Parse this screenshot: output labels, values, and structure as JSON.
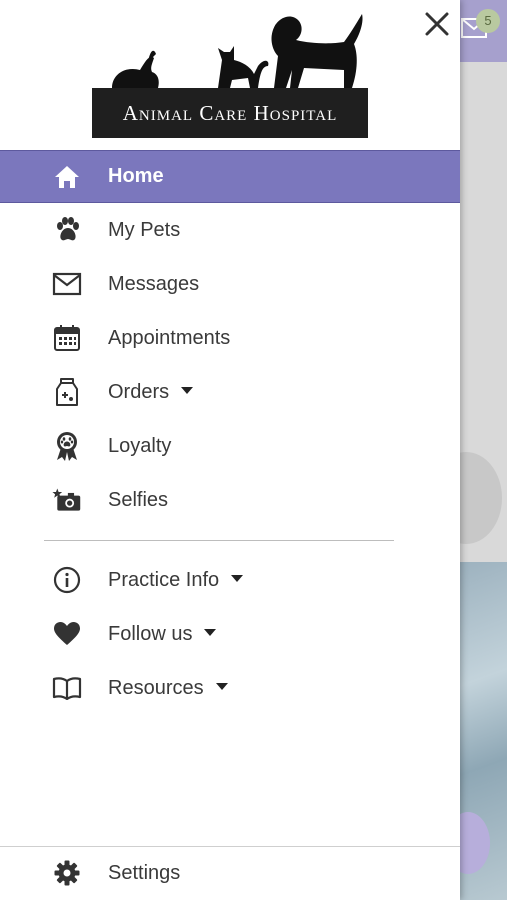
{
  "background": {
    "badge_count": "5"
  },
  "drawer": {
    "close_icon": "close-icon",
    "logo_text": "Animal Care Hospital",
    "menu": [
      {
        "label": "Home",
        "icon": "home-icon",
        "active": true
      },
      {
        "label": "My Pets",
        "icon": "paw-icon"
      },
      {
        "label": "Messages",
        "icon": "envelope-icon"
      },
      {
        "label": "Appointments",
        "icon": "calendar-icon"
      },
      {
        "label": "Orders",
        "icon": "food-bag-icon",
        "expandable": true
      },
      {
        "label": "Loyalty",
        "icon": "ribbon-icon"
      },
      {
        "label": "Selfies",
        "icon": "camera-icon"
      }
    ],
    "secondary_menu": [
      {
        "label": "Practice Info",
        "icon": "info-icon",
        "expandable": true
      },
      {
        "label": "Follow us",
        "icon": "heart-icon",
        "expandable": true
      },
      {
        "label": "Resources",
        "icon": "book-icon",
        "expandable": true
      }
    ],
    "settings_label": "Settings"
  },
  "colors": {
    "active_bg": "#7b77bd",
    "header_tint": "#a6a0cd",
    "text": "#3a3a3a"
  }
}
